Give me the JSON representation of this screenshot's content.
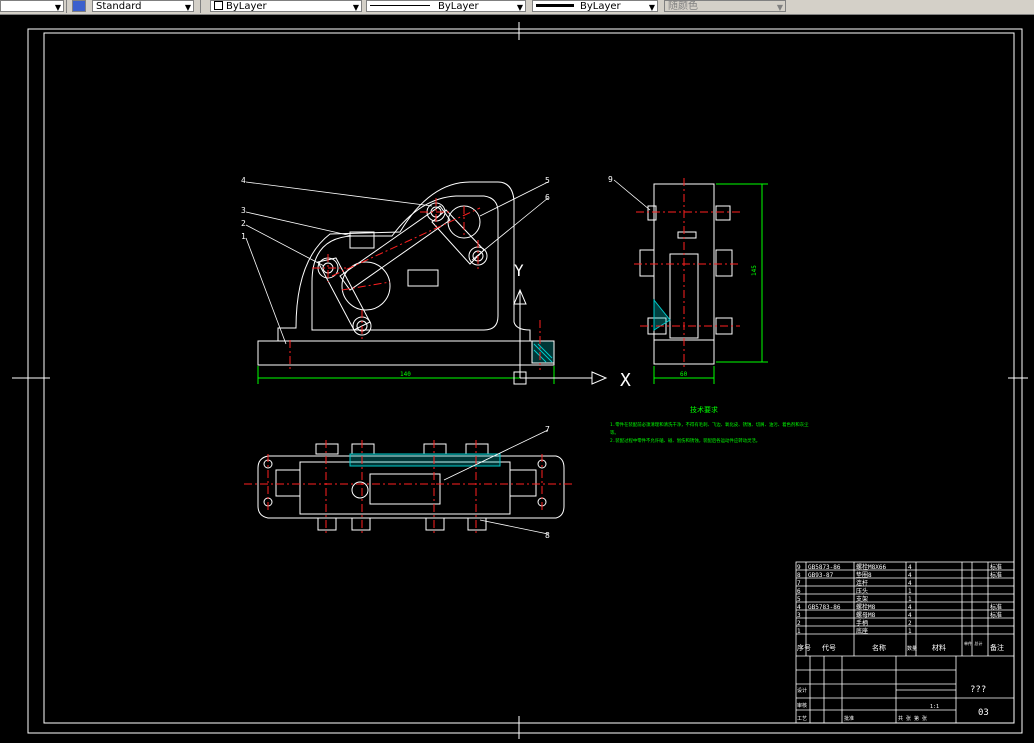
{
  "toolbar": {
    "textstyle": "Standard",
    "layer": "ByLayer",
    "linetype": "ByLayer",
    "lineweight": "ByLayer",
    "plotstyle": "随颜色"
  },
  "drawing": {
    "dim_length": "140",
    "dim_width": "60",
    "dim_height": "145",
    "ucs_x": "X",
    "ucs_y": "Y",
    "callouts": {
      "c4": "4",
      "c3": "3",
      "c2": "2",
      "c1": "1",
      "c5": "5",
      "c6": "6",
      "c9": "9",
      "c7": "7",
      "c8": "8"
    },
    "tech_title": "技术要求",
    "tech_line1": "1.零件在装配前必须清理和清洗干净，不得有毛刺、飞边、氧化皮、锈蚀、切屑、油污、着色剂和灰尘",
    "tech_line1b": "等。",
    "tech_line2": "2.装配过程中零件不允许磕、碰、划伤和锈蚀，装配后各运动件应转动灵活。"
  },
  "bom": {
    "rows": [
      {
        "no": "9",
        "code": "GB5873-86",
        "name": "螺栓M8X66",
        "qty": "4",
        "note": "标准"
      },
      {
        "no": "8",
        "code": "GB93-87",
        "name": "垫圈8",
        "qty": "4",
        "note": "标准"
      },
      {
        "no": "7",
        "code": "",
        "name": "连杆",
        "qty": "4",
        "note": ""
      },
      {
        "no": "6",
        "code": "",
        "name": "压头",
        "qty": "1",
        "note": ""
      },
      {
        "no": "5",
        "code": "",
        "name": "支架",
        "qty": "1",
        "note": ""
      },
      {
        "no": "4",
        "code": "GB5783-86",
        "name": "螺栓M8",
        "qty": "4",
        "note": "标准"
      },
      {
        "no": "3",
        "code": "",
        "name": "螺母M8",
        "qty": "4",
        "note": "标准"
      },
      {
        "no": "2",
        "code": "",
        "name": "手柄",
        "qty": "2",
        "note": ""
      },
      {
        "no": "1",
        "code": "",
        "name": "底座",
        "qty": "1",
        "note": ""
      }
    ],
    "header": {
      "no": "序号",
      "code": "代号",
      "name": "名称",
      "qty": "数量",
      "mat": "材料",
      "weight": "单件 总计",
      "note": "备注"
    },
    "title_name": "???",
    "drawing_no": "03",
    "scale": "1:1",
    "lbl_design": "设计",
    "lbl_review": "审核",
    "lbl_process": "工艺",
    "lbl_approve": "批准",
    "lbl_sheet": "共 张 第 张"
  }
}
